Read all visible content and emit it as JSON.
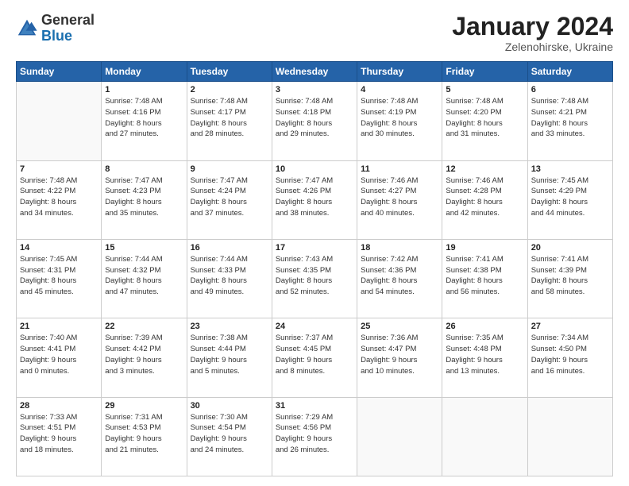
{
  "logo": {
    "general": "General",
    "blue": "Blue"
  },
  "header": {
    "month_year": "January 2024",
    "location": "Zelenohirske, Ukraine"
  },
  "days_of_week": [
    "Sunday",
    "Monday",
    "Tuesday",
    "Wednesday",
    "Thursday",
    "Friday",
    "Saturday"
  ],
  "weeks": [
    [
      {
        "day": "",
        "empty": true
      },
      {
        "day": "1",
        "sunrise": "Sunrise: 7:48 AM",
        "sunset": "Sunset: 4:16 PM",
        "daylight": "Daylight: 8 hours and 27 minutes."
      },
      {
        "day": "2",
        "sunrise": "Sunrise: 7:48 AM",
        "sunset": "Sunset: 4:17 PM",
        "daylight": "Daylight: 8 hours and 28 minutes."
      },
      {
        "day": "3",
        "sunrise": "Sunrise: 7:48 AM",
        "sunset": "Sunset: 4:18 PM",
        "daylight": "Daylight: 8 hours and 29 minutes."
      },
      {
        "day": "4",
        "sunrise": "Sunrise: 7:48 AM",
        "sunset": "Sunset: 4:19 PM",
        "daylight": "Daylight: 8 hours and 30 minutes."
      },
      {
        "day": "5",
        "sunrise": "Sunrise: 7:48 AM",
        "sunset": "Sunset: 4:20 PM",
        "daylight": "Daylight: 8 hours and 31 minutes."
      },
      {
        "day": "6",
        "sunrise": "Sunrise: 7:48 AM",
        "sunset": "Sunset: 4:21 PM",
        "daylight": "Daylight: 8 hours and 33 minutes."
      }
    ],
    [
      {
        "day": "7",
        "sunrise": "Sunrise: 7:48 AM",
        "sunset": "Sunset: 4:22 PM",
        "daylight": "Daylight: 8 hours and 34 minutes."
      },
      {
        "day": "8",
        "sunrise": "Sunrise: 7:47 AM",
        "sunset": "Sunset: 4:23 PM",
        "daylight": "Daylight: 8 hours and 35 minutes."
      },
      {
        "day": "9",
        "sunrise": "Sunrise: 7:47 AM",
        "sunset": "Sunset: 4:24 PM",
        "daylight": "Daylight: 8 hours and 37 minutes."
      },
      {
        "day": "10",
        "sunrise": "Sunrise: 7:47 AM",
        "sunset": "Sunset: 4:26 PM",
        "daylight": "Daylight: 8 hours and 38 minutes."
      },
      {
        "day": "11",
        "sunrise": "Sunrise: 7:46 AM",
        "sunset": "Sunset: 4:27 PM",
        "daylight": "Daylight: 8 hours and 40 minutes."
      },
      {
        "day": "12",
        "sunrise": "Sunrise: 7:46 AM",
        "sunset": "Sunset: 4:28 PM",
        "daylight": "Daylight: 8 hours and 42 minutes."
      },
      {
        "day": "13",
        "sunrise": "Sunrise: 7:45 AM",
        "sunset": "Sunset: 4:29 PM",
        "daylight": "Daylight: 8 hours and 44 minutes."
      }
    ],
    [
      {
        "day": "14",
        "sunrise": "Sunrise: 7:45 AM",
        "sunset": "Sunset: 4:31 PM",
        "daylight": "Daylight: 8 hours and 45 minutes."
      },
      {
        "day": "15",
        "sunrise": "Sunrise: 7:44 AM",
        "sunset": "Sunset: 4:32 PM",
        "daylight": "Daylight: 8 hours and 47 minutes."
      },
      {
        "day": "16",
        "sunrise": "Sunrise: 7:44 AM",
        "sunset": "Sunset: 4:33 PM",
        "daylight": "Daylight: 8 hours and 49 minutes."
      },
      {
        "day": "17",
        "sunrise": "Sunrise: 7:43 AM",
        "sunset": "Sunset: 4:35 PM",
        "daylight": "Daylight: 8 hours and 52 minutes."
      },
      {
        "day": "18",
        "sunrise": "Sunrise: 7:42 AM",
        "sunset": "Sunset: 4:36 PM",
        "daylight": "Daylight: 8 hours and 54 minutes."
      },
      {
        "day": "19",
        "sunrise": "Sunrise: 7:41 AM",
        "sunset": "Sunset: 4:38 PM",
        "daylight": "Daylight: 8 hours and 56 minutes."
      },
      {
        "day": "20",
        "sunrise": "Sunrise: 7:41 AM",
        "sunset": "Sunset: 4:39 PM",
        "daylight": "Daylight: 8 hours and 58 minutes."
      }
    ],
    [
      {
        "day": "21",
        "sunrise": "Sunrise: 7:40 AM",
        "sunset": "Sunset: 4:41 PM",
        "daylight": "Daylight: 9 hours and 0 minutes."
      },
      {
        "day": "22",
        "sunrise": "Sunrise: 7:39 AM",
        "sunset": "Sunset: 4:42 PM",
        "daylight": "Daylight: 9 hours and 3 minutes."
      },
      {
        "day": "23",
        "sunrise": "Sunrise: 7:38 AM",
        "sunset": "Sunset: 4:44 PM",
        "daylight": "Daylight: 9 hours and 5 minutes."
      },
      {
        "day": "24",
        "sunrise": "Sunrise: 7:37 AM",
        "sunset": "Sunset: 4:45 PM",
        "daylight": "Daylight: 9 hours and 8 minutes."
      },
      {
        "day": "25",
        "sunrise": "Sunrise: 7:36 AM",
        "sunset": "Sunset: 4:47 PM",
        "daylight": "Daylight: 9 hours and 10 minutes."
      },
      {
        "day": "26",
        "sunrise": "Sunrise: 7:35 AM",
        "sunset": "Sunset: 4:48 PM",
        "daylight": "Daylight: 9 hours and 13 minutes."
      },
      {
        "day": "27",
        "sunrise": "Sunrise: 7:34 AM",
        "sunset": "Sunset: 4:50 PM",
        "daylight": "Daylight: 9 hours and 16 minutes."
      }
    ],
    [
      {
        "day": "28",
        "sunrise": "Sunrise: 7:33 AM",
        "sunset": "Sunset: 4:51 PM",
        "daylight": "Daylight: 9 hours and 18 minutes."
      },
      {
        "day": "29",
        "sunrise": "Sunrise: 7:31 AM",
        "sunset": "Sunset: 4:53 PM",
        "daylight": "Daylight: 9 hours and 21 minutes."
      },
      {
        "day": "30",
        "sunrise": "Sunrise: 7:30 AM",
        "sunset": "Sunset: 4:54 PM",
        "daylight": "Daylight: 9 hours and 24 minutes."
      },
      {
        "day": "31",
        "sunrise": "Sunrise: 7:29 AM",
        "sunset": "Sunset: 4:56 PM",
        "daylight": "Daylight: 9 hours and 26 minutes."
      },
      {
        "day": "",
        "empty": true
      },
      {
        "day": "",
        "empty": true
      },
      {
        "day": "",
        "empty": true
      }
    ]
  ]
}
